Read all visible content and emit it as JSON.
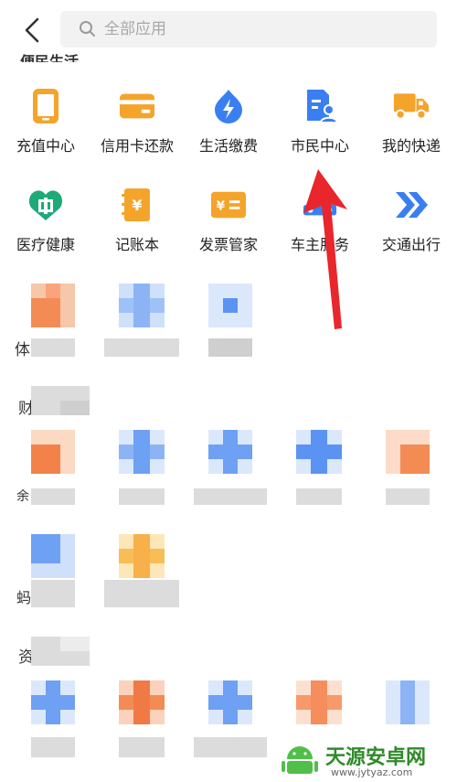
{
  "header": {
    "search_placeholder": "全部应用",
    "partial_section_title": "便民生活"
  },
  "apps": [
    {
      "label": "充值中心",
      "icon": "phone-icon",
      "color": "#f4a42a"
    },
    {
      "label": "信用卡还款",
      "icon": "credit-card-icon",
      "color": "#f4a42a"
    },
    {
      "label": "生活缴费",
      "icon": "lightning-drop-icon",
      "color": "#3a7ff2"
    },
    {
      "label": "市民中心",
      "icon": "citizen-card-icon",
      "color": "#3a7ff2"
    },
    {
      "label": "我的快递",
      "icon": "truck-icon",
      "color": "#f4a42a"
    },
    {
      "label": "医疗健康",
      "icon": "heart-shield-icon",
      "color": "#1eaa78"
    },
    {
      "label": "记账本",
      "icon": "ledger-icon",
      "color": "#f4a42a"
    },
    {
      "label": "发票管家",
      "icon": "invoice-icon",
      "color": "#f4a42a"
    },
    {
      "label": "车主服务",
      "icon": "car-icon",
      "color": "#3a7ff2"
    },
    {
      "label": "交通出行",
      "icon": "double-chevron-icon",
      "color": "#3a7ff2"
    }
  ],
  "sections": {
    "s1_char": "体",
    "s2_char": "财",
    "s2_item_char": "余",
    "s3_char": "蚂",
    "s4_char": "资"
  },
  "watermark": {
    "title": "天源安卓网",
    "url": "www.jytyaz.com"
  },
  "colors": {
    "blue": "#3a7ff2",
    "orange": "#f4a42a",
    "arrow": "#e8262b"
  }
}
